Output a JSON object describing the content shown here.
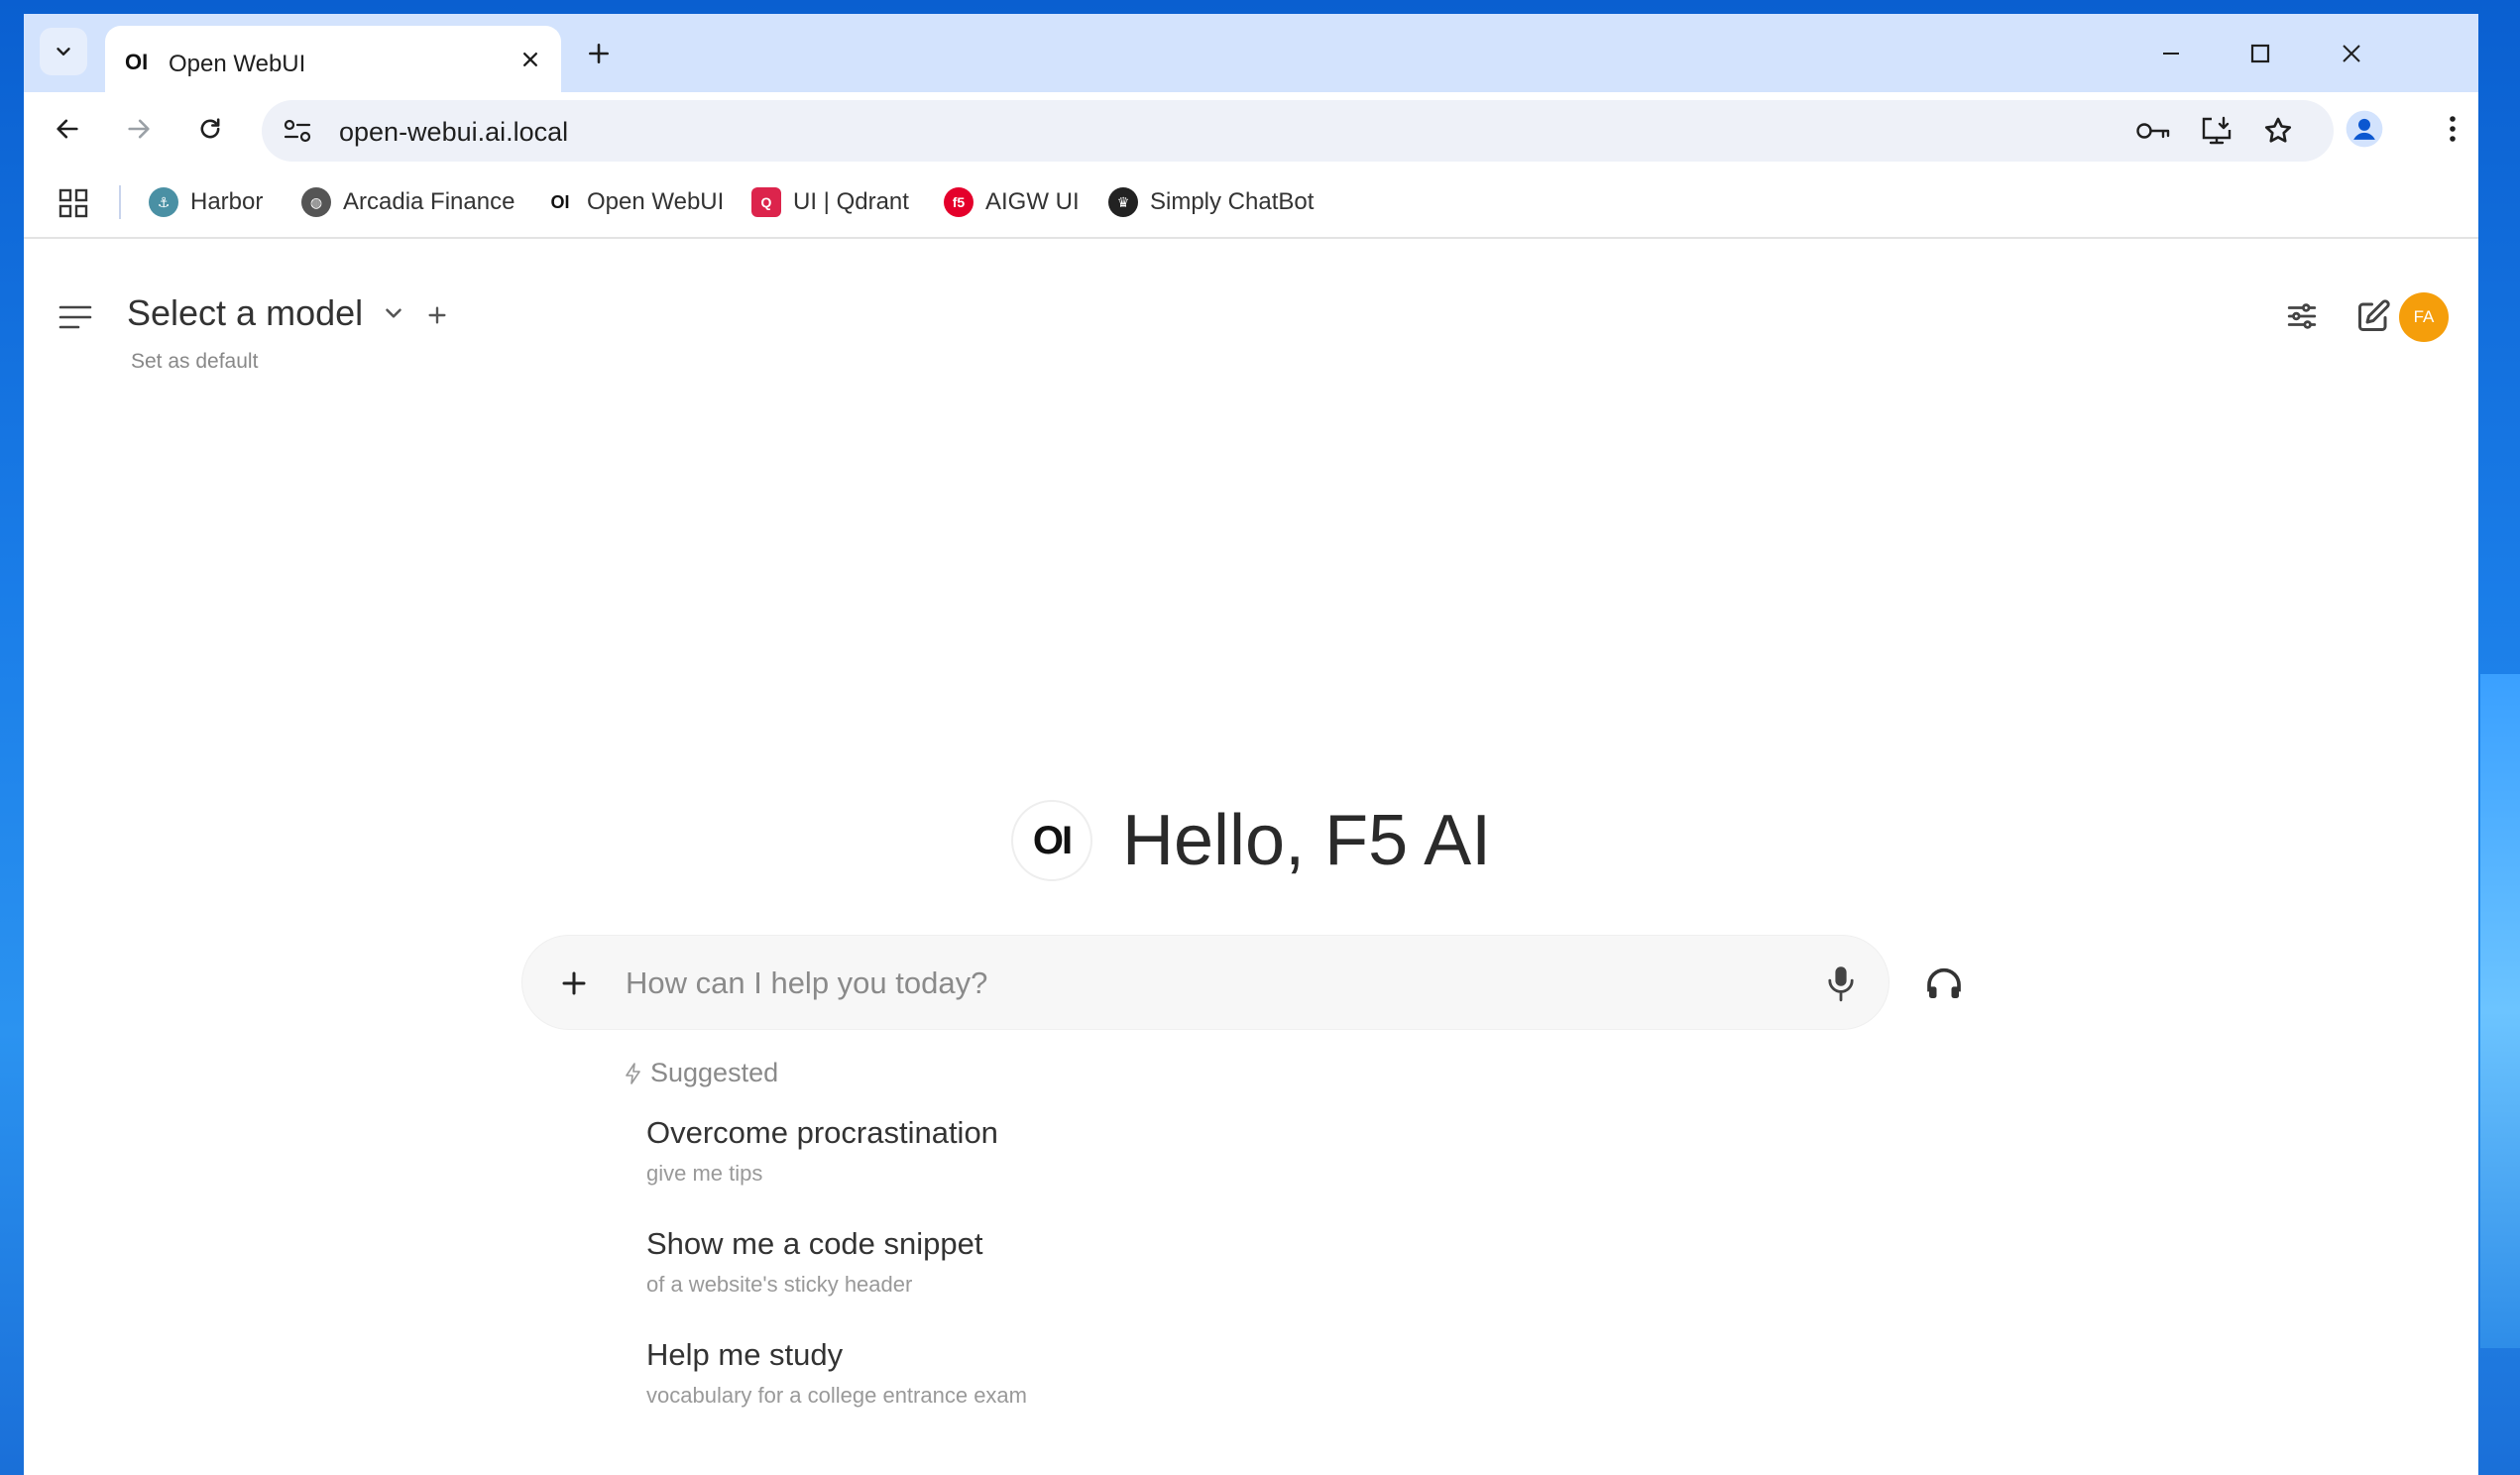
{
  "browser": {
    "tab": {
      "title": "Open WebUI",
      "favicon": "OI"
    },
    "address": "open-webui.ai.local",
    "bookmarks": [
      {
        "label": "Harbor",
        "icon": "harbor-icon",
        "color": "#4a90a4"
      },
      {
        "label": "Arcadia Finance",
        "icon": "globe-icon",
        "color": "#555555"
      },
      {
        "label": "Open WebUI",
        "icon": "openwebui-icon",
        "color": "#111111"
      },
      {
        "label": "UI | Qdrant",
        "icon": "qdrant-icon",
        "color": "#dc244c"
      },
      {
        "label": "AIGW UI",
        "icon": "f5-icon",
        "color": "#e4002b"
      },
      {
        "label": "Simply ChatBot",
        "icon": "crown-icon",
        "color": "#222222"
      }
    ]
  },
  "app": {
    "model_selector": "Select a model",
    "set_default": "Set as default",
    "avatar_initials": "FA",
    "avatar_color": "#f59e0b",
    "logo_text": "OI",
    "greeting": "Hello, F5 AI",
    "chat_placeholder": "How can I help you today?",
    "suggested_label": "Suggested",
    "suggestions": [
      {
        "title": "Overcome procrastination",
        "subtitle": "give me tips"
      },
      {
        "title": "Show me a code snippet",
        "subtitle": "of a website's sticky header"
      },
      {
        "title": "Help me study",
        "subtitle": "vocabulary for a college entrance exam"
      }
    ]
  }
}
